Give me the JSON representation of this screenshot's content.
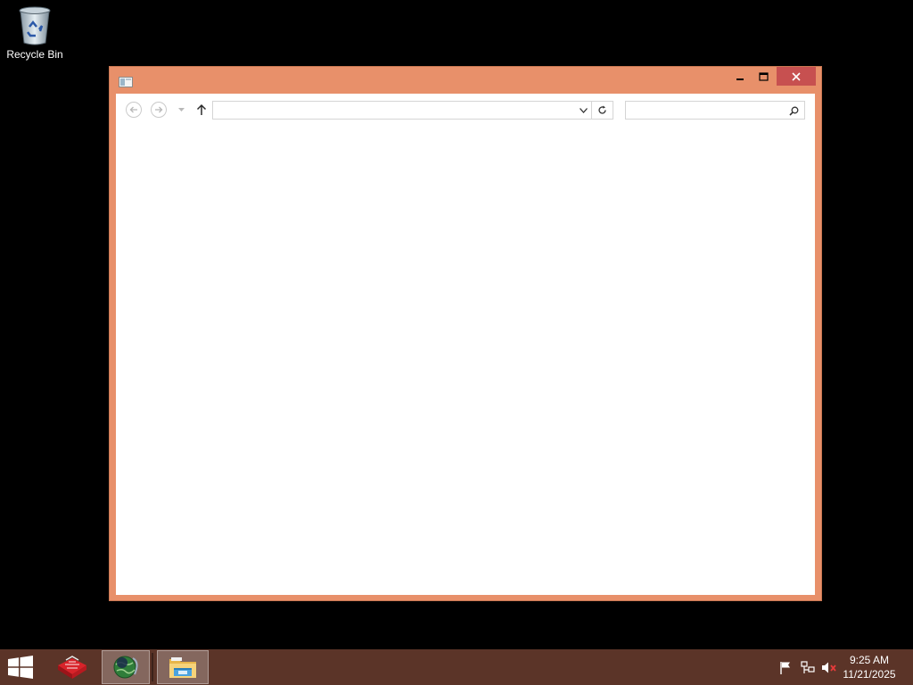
{
  "desktop": {
    "recycle_bin_label": "Recycle Bin"
  },
  "window": {
    "title": "",
    "address_value": "",
    "search_placeholder": "",
    "icons": {
      "back": "back-arrow-icon",
      "forward": "forward-arrow-icon",
      "recent": "chevron-down-icon",
      "up": "up-arrow-icon",
      "refresh": "refresh-icon",
      "search": "search-icon"
    }
  },
  "taskbar": {
    "clock_time": "9:25 AM",
    "clock_date": "11/21/2025",
    "pinned": [
      "app-icon",
      "web-browser-icon",
      "file-explorer-icon"
    ]
  },
  "colors": {
    "window_frame": "#e8906a",
    "close_button": "#c75050",
    "taskbar": "#5b3428",
    "desktop": "#000000"
  }
}
